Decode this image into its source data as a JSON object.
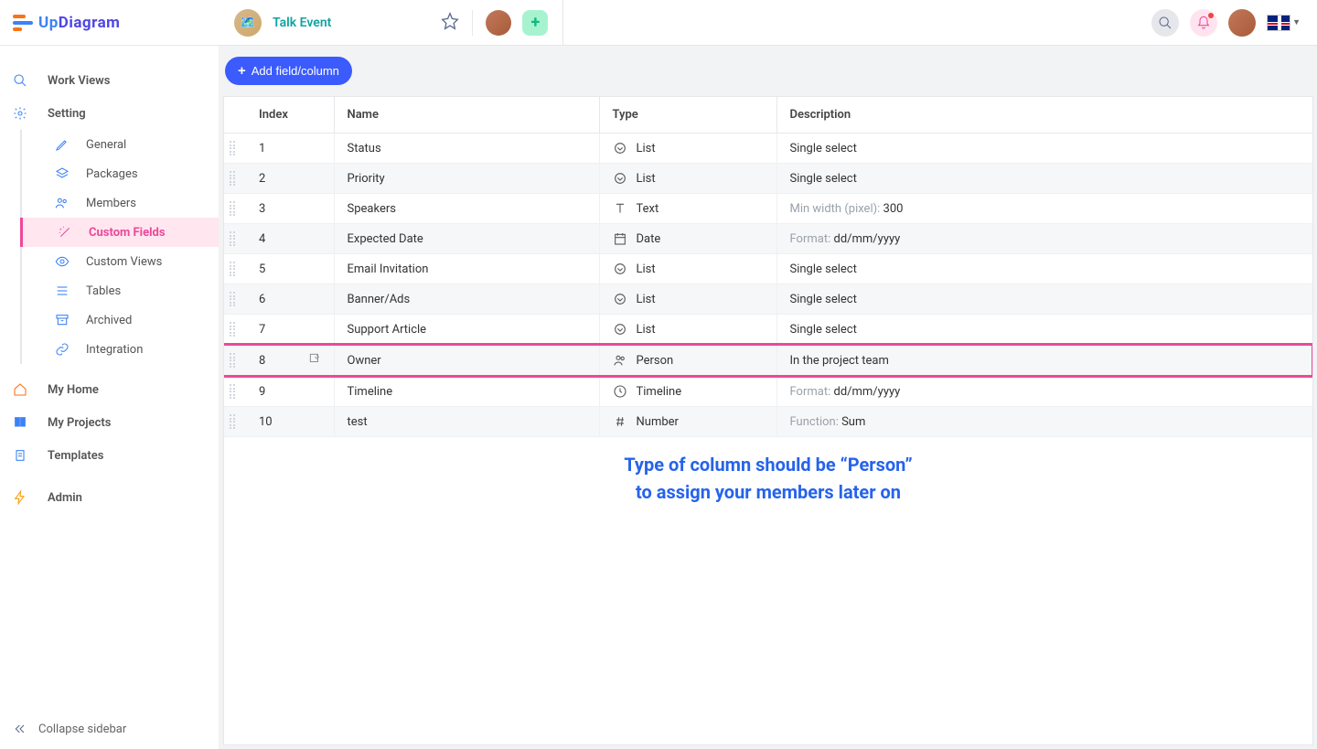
{
  "brand": {
    "name": "UpDiagram",
    "prefix": "Up",
    "suffix": "Diagram"
  },
  "project": {
    "title": "Talk Event"
  },
  "sidebar": {
    "workviews": "Work Views",
    "setting": "Setting",
    "subs": {
      "general": "General",
      "packages": "Packages",
      "members": "Members",
      "custom_fields": "Custom Fields",
      "custom_views": "Custom Views",
      "tables": "Tables",
      "archived": "Archived",
      "integration": "Integration"
    },
    "myhome": "My Home",
    "myprojects": "My Projects",
    "templates": "Templates",
    "admin": "Admin",
    "collapse": "Collapse sidebar"
  },
  "toolbar": {
    "add_field": "Add field/column"
  },
  "table": {
    "headers": {
      "index": "Index",
      "name": "Name",
      "type": "Type",
      "description": "Description"
    },
    "labels": {
      "min_width": "Min width (pixel): ",
      "format": "Format: ",
      "function": "Function: "
    },
    "rows": [
      {
        "index": "1",
        "name": "Status",
        "type_icon": "list",
        "type": "List",
        "desc": "Single select"
      },
      {
        "index": "2",
        "name": "Priority",
        "type_icon": "list",
        "type": "List",
        "desc": "Single select"
      },
      {
        "index": "3",
        "name": "Speakers",
        "type_icon": "text",
        "type": "Text",
        "desc_label": "min_width",
        "desc_value": "300"
      },
      {
        "index": "4",
        "name": "Expected Date",
        "type_icon": "date",
        "type": "Date",
        "desc_label": "format",
        "desc_value": "dd/mm/yyyy"
      },
      {
        "index": "5",
        "name": "Email Invitation",
        "type_icon": "list",
        "type": "List",
        "desc": "Single select"
      },
      {
        "index": "6",
        "name": "Banner/Ads",
        "type_icon": "list",
        "type": "List",
        "desc": "Single select"
      },
      {
        "index": "7",
        "name": "Support Article",
        "type_icon": "list",
        "type": "List",
        "desc": "Single select"
      },
      {
        "index": "8",
        "name": "Owner",
        "type_icon": "person",
        "type": "Person",
        "desc": "In the project team",
        "highlight": true
      },
      {
        "index": "9",
        "name": "Timeline",
        "type_icon": "timeline",
        "type": "Timeline",
        "desc_label": "format",
        "desc_value": "dd/mm/yyyy"
      },
      {
        "index": "10",
        "name": "test",
        "type_icon": "number",
        "type": "Number",
        "desc_label": "function",
        "desc_value": "Sum"
      }
    ]
  },
  "annotation": {
    "line1": "Type of column should be “Person”",
    "line2": "to assign your members later on"
  }
}
